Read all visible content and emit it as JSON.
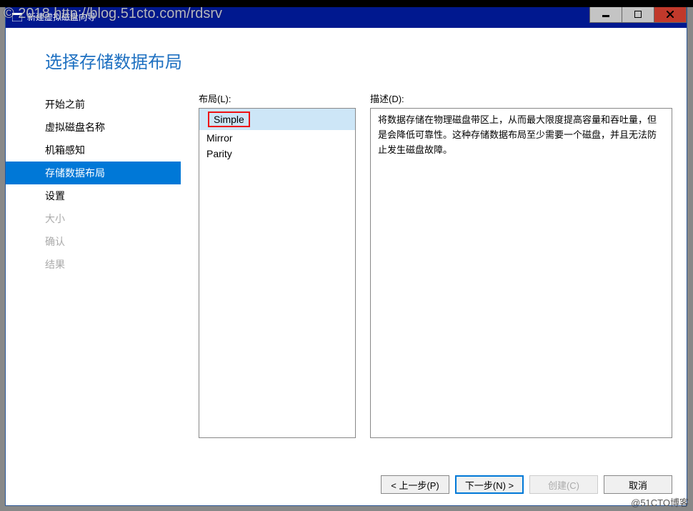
{
  "window": {
    "title": "新建虚拟磁盘向导"
  },
  "header": {
    "title": "选择存储数据布局"
  },
  "sidebar": {
    "items": [
      {
        "label": "开始之前",
        "state": "normal"
      },
      {
        "label": "虚拟磁盘名称",
        "state": "normal"
      },
      {
        "label": "机箱感知",
        "state": "normal"
      },
      {
        "label": "存储数据布局",
        "state": "selected"
      },
      {
        "label": "设置",
        "state": "normal"
      },
      {
        "label": "大小",
        "state": "disabled"
      },
      {
        "label": "确认",
        "state": "disabled"
      },
      {
        "label": "结果",
        "state": "disabled"
      }
    ]
  },
  "layout_panel": {
    "label": "布局(L):",
    "items": [
      {
        "name": "Simple",
        "selected": true,
        "highlighted": true
      },
      {
        "name": "Mirror",
        "selected": false,
        "highlighted": false
      },
      {
        "name": "Parity",
        "selected": false,
        "highlighted": false
      }
    ]
  },
  "description_panel": {
    "label": "描述(D):",
    "text": "将数据存储在物理磁盘带区上，从而最大限度提高容量和吞吐量，但是会降低可靠性。这种存储数据布局至少需要一个磁盘，并且无法防止发生磁盘故障。"
  },
  "buttons": {
    "prev": "< 上一步(P)",
    "next": "下一步(N) >",
    "create": "创建(C)",
    "cancel": "取消"
  },
  "watermarks": {
    "top": "© 2018 http://blog.51cto.com/rdsrv",
    "bottom": "@51CTO博客"
  }
}
